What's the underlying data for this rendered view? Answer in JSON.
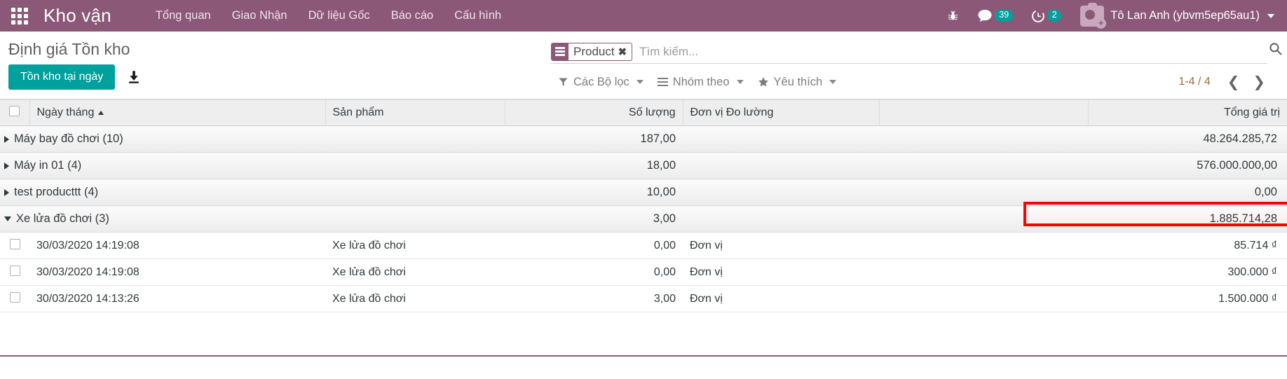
{
  "navbar": {
    "apps_icon": "apps-grid-icon",
    "brand": "Kho vận",
    "menu": [
      {
        "label": "Tổng quan"
      },
      {
        "label": "Giao Nhận"
      },
      {
        "label": "Dữ liệu Gốc"
      },
      {
        "label": "Báo cáo"
      },
      {
        "label": "Cấu hình"
      }
    ],
    "bug_icon": "bug-icon",
    "messages": {
      "icon": "chat-bubble-icon",
      "count": "39"
    },
    "activities": {
      "icon": "clock-icon",
      "count": "2"
    },
    "user": {
      "avatar_icon": "camera-avatar-icon",
      "name": "Tô Lan Anh (ybvm5ep65au1)"
    },
    "accent_color": "#8C5878"
  },
  "control_panel": {
    "title": "Định giá Tồn kho",
    "primary_button": "Tồn kho tại ngày",
    "download_icon": "download-icon",
    "button_color": "#00A09D",
    "search": {
      "facet_label": "Product",
      "facet_icon": "list-icon",
      "facet_close_icon": "close-icon",
      "placeholder": "Tìm kiếm...",
      "value": "",
      "search_icon": "search-icon"
    },
    "filters": {
      "label": "Các Bộ lọc",
      "icon": "filter-funnel-icon"
    },
    "groupby": {
      "label": "Nhóm theo",
      "icon": "hamburger-icon"
    },
    "favorites": {
      "label": "Yêu thích",
      "icon": "star-icon"
    },
    "pager": {
      "count": "1-4 / 4",
      "prev_icon": "chevron-left-icon",
      "next_icon": "chevron-right-icon"
    }
  },
  "table": {
    "columns": [
      {
        "key": "date",
        "label": "Ngày tháng",
        "sort": "asc"
      },
      {
        "key": "product",
        "label": "Sản phẩm"
      },
      {
        "key": "qty",
        "label": "Số lượng"
      },
      {
        "key": "uom",
        "label": "Đơn vị Đo lường"
      },
      {
        "key": "blank",
        "label": ""
      },
      {
        "key": "total",
        "label": "Tổng giá trị"
      }
    ],
    "groups": [
      {
        "name": "Máy bay đồ chơi (10)",
        "expanded": false,
        "qty": "187,00",
        "total": "48.264.285,72",
        "rows": []
      },
      {
        "name": "Máy in 01 (4)",
        "expanded": false,
        "qty": "18,00",
        "total": "576.000.000,00",
        "rows": []
      },
      {
        "name": "test producttt (4)",
        "expanded": false,
        "qty": "10,00",
        "total": "0,00",
        "rows": []
      },
      {
        "name": "Xe lửa đồ chơi (3)",
        "expanded": true,
        "qty": "3,00",
        "total": "1.885.714,28",
        "highlighted": true,
        "rows": [
          {
            "date": "30/03/2020 14:19:08",
            "product": "Xe lửa đồ chơi",
            "qty": "0,00",
            "uom": "Đơn vị",
            "total": "85.714 ₫"
          },
          {
            "date": "30/03/2020 14:19:08",
            "product": "Xe lửa đồ chơi",
            "qty": "0,00",
            "uom": "Đơn vị",
            "total": "300.000 ₫"
          },
          {
            "date": "30/03/2020 14:13:26",
            "product": "Xe lửa đồ chơi",
            "qty": "3,00",
            "uom": "Đơn vị",
            "total": "1.500.000 ₫"
          }
        ]
      }
    ]
  },
  "annotation": {
    "highlight_color": "#FF0000"
  }
}
